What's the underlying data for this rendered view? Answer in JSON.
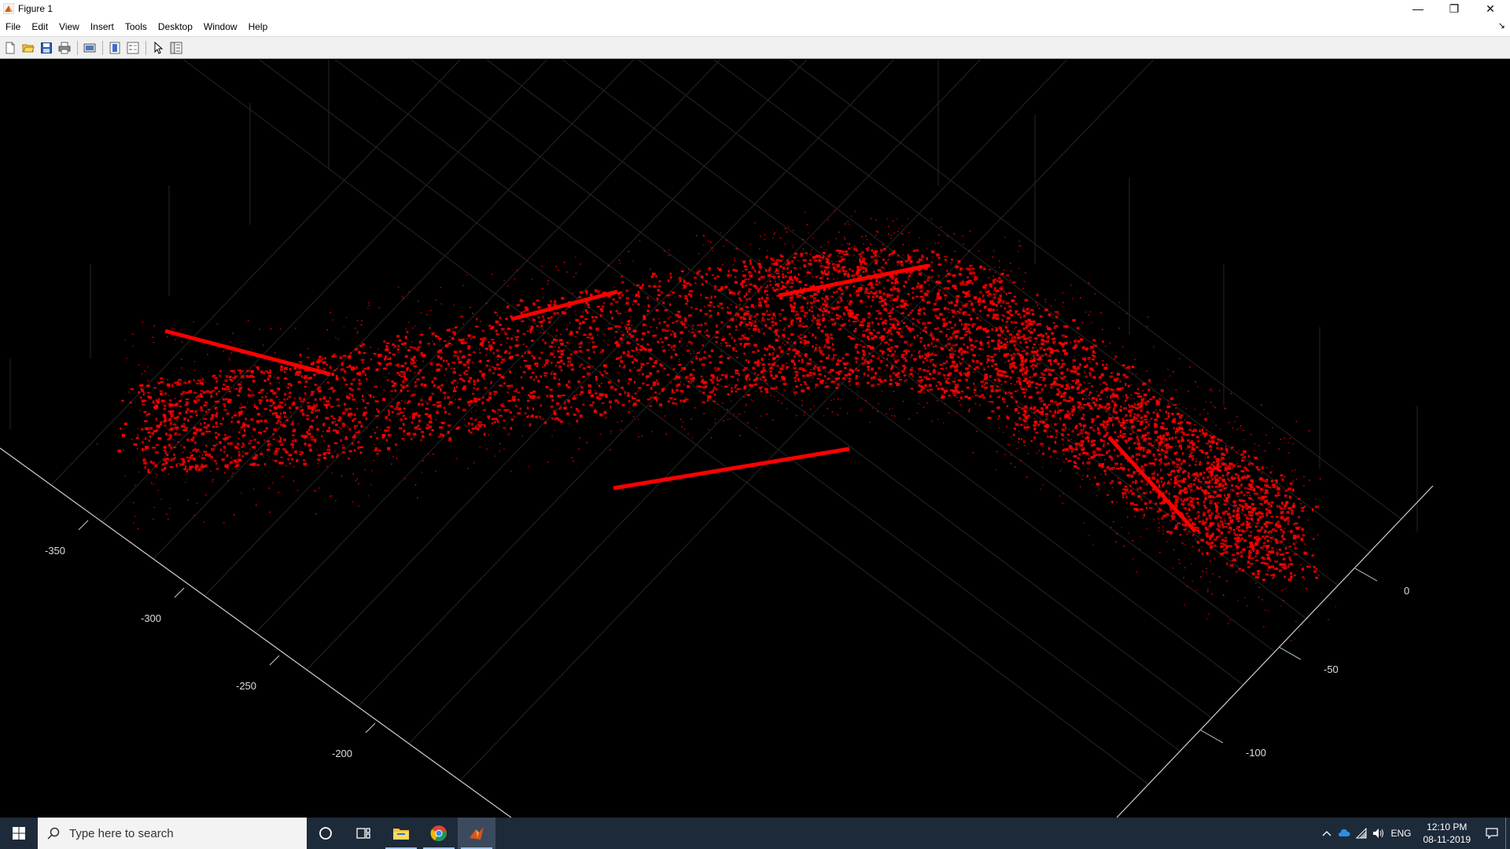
{
  "window": {
    "title": "Figure 1",
    "controls": {
      "minimize": "—",
      "restore": "❐",
      "close": "✕"
    }
  },
  "menu": [
    "File",
    "Edit",
    "View",
    "Insert",
    "Tools",
    "Desktop",
    "Window",
    "Help"
  ],
  "toolbar": {
    "buttons": [
      "new-figure-icon",
      "open-file-icon",
      "save-icon",
      "print-icon",
      "print-preview-icon",
      "colorbar-icon",
      "legend-icon",
      "edit-plot-arrow-icon",
      "property-inspector-icon"
    ]
  },
  "plot": {
    "background": "#000000",
    "point_color": "#ff0000",
    "x_axis_ticks": [
      "-350",
      "-300",
      "-250",
      "-200"
    ],
    "y_axis_ticks": [
      "0",
      "-50",
      "-100"
    ]
  },
  "taskbar": {
    "search_placeholder": "Type here to search",
    "apps": [
      "cortana-icon",
      "task-view-icon",
      "file-explorer-icon",
      "chrome-icon",
      "matlab-icon"
    ],
    "tray": {
      "language": "ENG",
      "time": "12:10 PM",
      "date": "08-11-2019"
    }
  }
}
